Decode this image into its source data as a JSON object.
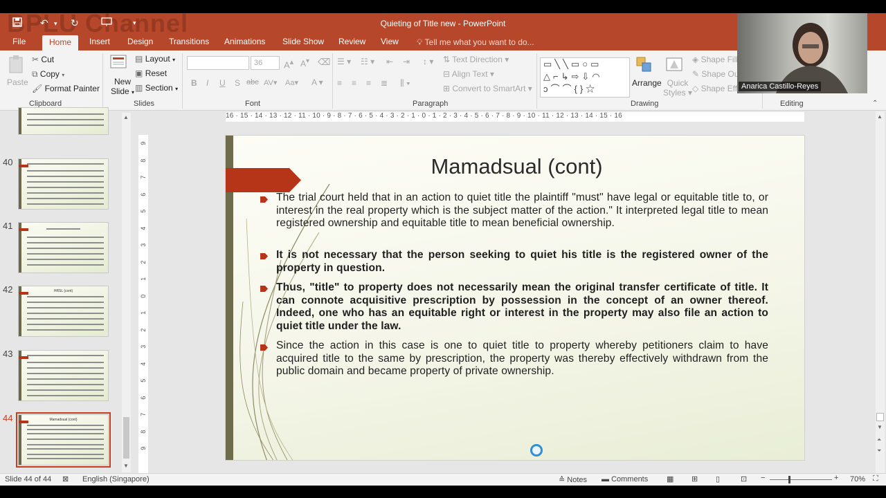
{
  "watermark": "BPLU Channel",
  "window": {
    "title": "Quieting of Title new - PowerPoint"
  },
  "tabs": [
    "File",
    "Home",
    "Insert",
    "Design",
    "Transitions",
    "Animations",
    "Slide Show",
    "Review",
    "View"
  ],
  "tell_me": "Tell me what you want to do...",
  "ribbon": {
    "clipboard": {
      "paste": "Paste",
      "cut": "Cut",
      "copy": "Copy",
      "format_painter": "Format Painter",
      "label": "Clipboard"
    },
    "slides": {
      "new_slide_1": "New",
      "new_slide_2": "Slide",
      "layout": "Layout",
      "reset": "Reset",
      "section": "Section",
      "label": "Slides"
    },
    "font": {
      "size": "36",
      "bold": "B",
      "italic": "I",
      "underline": "U",
      "shadow": "S",
      "label": "Font"
    },
    "paragraph": {
      "text_direction": "Text Direction",
      "align_text": "Align Text",
      "smartart": "Convert to SmartArt",
      "label": "Paragraph"
    },
    "drawing": {
      "arrange": "Arrange",
      "quick_1": "Quick",
      "quick_2": "Styles",
      "shape_fill": "Shape Fill",
      "shape_outline": "Shape Ou",
      "shape_effects": "Shape Eff",
      "label": "Drawing"
    },
    "editing": {
      "label": "Editing"
    }
  },
  "thumbnails": [
    {
      "number": "40",
      "title": ""
    },
    {
      "number": "41",
      "title": ""
    },
    {
      "number": "42",
      "title": "HRSL (cont)"
    },
    {
      "number": "43",
      "title": ""
    },
    {
      "number": "44",
      "title": "Mamadsual (cont)",
      "selected": true
    }
  ],
  "ruler": {
    "h": "16 · 15 · 14 · 13 · 12 · 11 · 10 · 9 · 8 · 7 · 6 · 5 · 4 · 3 · 2 · 1 · 0 · 1 · 2 · 3 · 4 · 5 · 6 · 7 · 8 · 9 · 10 · 11 · 12 · 13 · 14 · 15 · 16"
  },
  "slide": {
    "title": "Mamadsual (cont)",
    "bullets": [
      {
        "text": "The trial court held that in an action to quiet title the plaintiff \"must\" have legal or equitable title to, or interest in the real property which is the subject matter of the action.\" It interpreted legal title to mean registered ownership and equitable title to mean beneficial ownership.",
        "bold": false
      },
      {
        "text": "It is not necessary that the person seeking to quiet his title is the registered owner of the property in question.",
        "bold": true
      },
      {
        "text": "Thus, \"title\" to property does not necessarily mean the original transfer certificate of title. It can connote acquisitive prescription by possession in the concept of an owner thereof. Indeed, one who has an equitable right or interest in the property may also file an action to quiet title under the law.",
        "bold": true
      },
      {
        "text": "Since the action in this case is one to quiet title to property whereby petitioners claim to have acquired title to the same by prescription, the property was thereby effectively withdrawn from the public domain and became property of private ownership.",
        "bold": false
      }
    ]
  },
  "status": {
    "slide": "Slide 44 of 44",
    "language": "English (Singapore)",
    "notes": "Notes",
    "comments": "Comments",
    "zoom": "70%"
  },
  "webcam": {
    "name": "Anarica Castillo-Reyes"
  },
  "colors": {
    "accent": "#b7472a",
    "selection": "#c43e1c",
    "slide_bar": "#6f6b4d"
  }
}
